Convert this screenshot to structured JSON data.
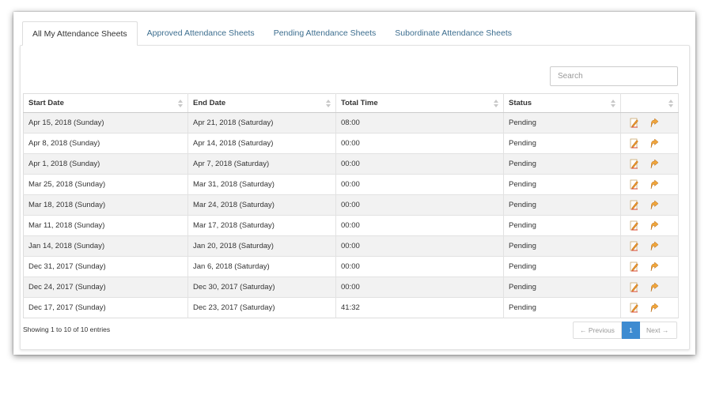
{
  "tabs": [
    {
      "label": "All My Attendance Sheets",
      "active": true
    },
    {
      "label": "Approved Attendance Sheets",
      "active": false
    },
    {
      "label": "Pending Attendance Sheets",
      "active": false
    },
    {
      "label": "Subordinate Attendance Sheets",
      "active": false
    }
  ],
  "search": {
    "placeholder": "Search"
  },
  "table": {
    "columns": [
      "Start Date",
      "End Date",
      "Total Time",
      "Status",
      ""
    ],
    "rows": [
      {
        "start": "Apr 15, 2018 (Sunday)",
        "end": "Apr 21, 2018 (Saturday)",
        "total": "08:00",
        "status": "Pending"
      },
      {
        "start": "Apr 8, 2018 (Sunday)",
        "end": "Apr 14, 2018 (Saturday)",
        "total": "00:00",
        "status": "Pending"
      },
      {
        "start": "Apr 1, 2018 (Sunday)",
        "end": "Apr 7, 2018 (Saturday)",
        "total": "00:00",
        "status": "Pending"
      },
      {
        "start": "Mar 25, 2018 (Sunday)",
        "end": "Mar 31, 2018 (Saturday)",
        "total": "00:00",
        "status": "Pending"
      },
      {
        "start": "Mar 18, 2018 (Sunday)",
        "end": "Mar 24, 2018 (Saturday)",
        "total": "00:00",
        "status": "Pending"
      },
      {
        "start": "Mar 11, 2018 (Sunday)",
        "end": "Mar 17, 2018 (Saturday)",
        "total": "00:00",
        "status": "Pending"
      },
      {
        "start": "Jan 14, 2018 (Sunday)",
        "end": "Jan 20, 2018 (Saturday)",
        "total": "00:00",
        "status": "Pending"
      },
      {
        "start": "Dec 31, 2017 (Sunday)",
        "end": "Jan 6, 2018 (Saturday)",
        "total": "00:00",
        "status": "Pending"
      },
      {
        "start": "Dec 24, 2017 (Sunday)",
        "end": "Dec 30, 2017 (Saturday)",
        "total": "00:00",
        "status": "Pending"
      },
      {
        "start": "Dec 17, 2017 (Sunday)",
        "end": "Dec 23, 2017 (Saturday)",
        "total": "41:32",
        "status": "Pending"
      }
    ],
    "row_actions": [
      "edit-sheet-icon",
      "submit-sheet-icon"
    ]
  },
  "footer": {
    "info": "Showing 1 to 10 of 10 entries",
    "prev": "← Previous",
    "page": "1",
    "next": "Next →"
  },
  "colors": {
    "tab_link": "#3d6e8f",
    "pager_active": "#3d8bd1",
    "row_stripe": "#f2f2f2",
    "icon_orange": "#e8942c"
  }
}
